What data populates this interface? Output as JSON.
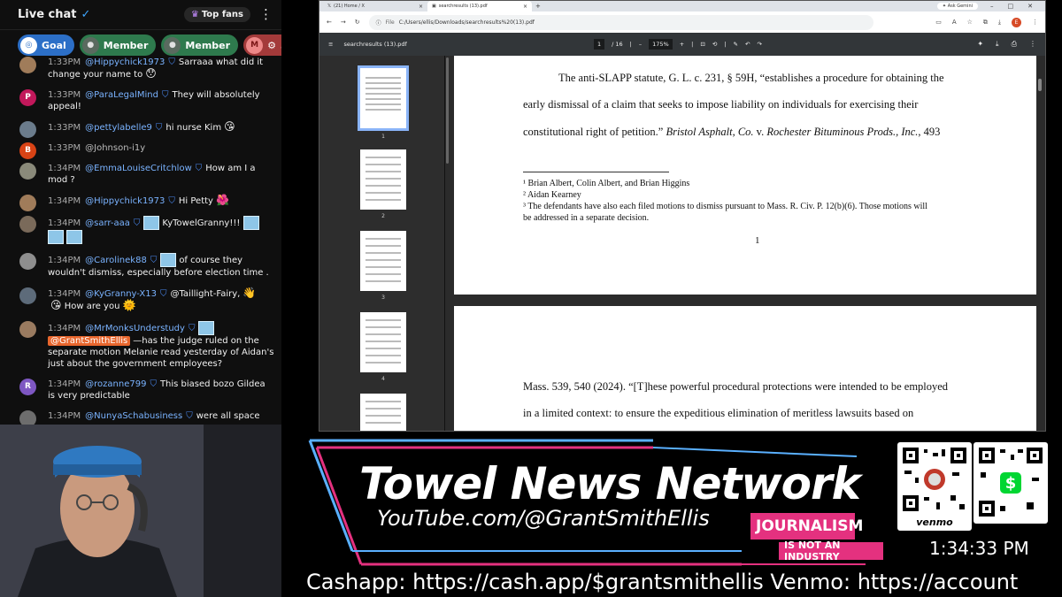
{
  "chat": {
    "title": "Live chat",
    "top_fans": "Top fans",
    "chips": {
      "goal": "Goal",
      "member1": "Member",
      "member2": "Member",
      "m_avatar": "M",
      "m_count": "5"
    },
    "messages": [
      {
        "time": "1:33PM",
        "author": "@Hippychick1973",
        "text": "Sarraaa what did it change your name to",
        "emoji": "😯",
        "avatar_color": "#a07c5a"
      },
      {
        "time": "1:33PM",
        "author": "@ParaLegalMind",
        "text": "They will absolutely appeal!",
        "avatar_letter": "P",
        "avatar_color": "#c2185b"
      },
      {
        "time": "1:33PM",
        "author": "@pettylabelle9",
        "text": "hi nurse Kim",
        "emoji": "😘",
        "avatar_color": "#6b7c8c"
      },
      {
        "time": "1:33PM",
        "author": "@Johnson-i1y",
        "text": "",
        "avatar_letter": "B",
        "avatar_color": "#d84315"
      },
      {
        "time": "1:34PM",
        "author": "@EmmaLouiseCritchlow",
        "text": "How am I a mod ?",
        "avatar_color": "#8a8a7a"
      },
      {
        "time": "1:34PM",
        "author": "@Hippychick1973",
        "text": "Hi Petty",
        "emoji": "🌺",
        "avatar_color": "#a07c5a"
      },
      {
        "time": "1:34PM",
        "author": "@sarr-aaa",
        "text": "KyTowelGranny!!!",
        "avatar_color": "#7a6a5a"
      },
      {
        "time": "1:34PM",
        "author": "@Carolinek88",
        "text": "of course they wouldn't dismiss, especially before election time .",
        "avatar_color": "#8e8e8e"
      },
      {
        "time": "1:34PM",
        "author": "@KyGranny-X13",
        "text": "@Taillight-Fairy,",
        "emoji2": "👋",
        "text2": "How are you",
        "emoji3": "🌞",
        "emoji": "😘",
        "avatar_color": "#5d6b7a"
      },
      {
        "time": "1:34PM",
        "author": "@MrMonksUnderstudy",
        "tag": "@GrantSmithEllis",
        "text": "—has the judge ruled on the separate motion Melanie read yesterday of Aidan's just about the government employees?",
        "avatar_color": "#9a7b60"
      },
      {
        "time": "1:34PM",
        "author": "@rozanne799",
        "text": "This biased bozo Gildea is very predictable",
        "avatar_letter": "R",
        "avatar_color": "#7e57c2"
      },
      {
        "time": "1:34PM",
        "author": "@NunyaSchabusiness",
        "text": "were all space",
        "avatar_color": "#6d6d6d"
      }
    ]
  },
  "browser": {
    "tabs": [
      {
        "label": "(21) Home / X"
      },
      {
        "label": "searchresults (13).pdf"
      }
    ],
    "gemini": "Ask Gemini",
    "url_prefix": "File",
    "url": "C:/Users/ellis/Downloads/searchresults%20(13).pdf",
    "profile_letter": "E",
    "pdf": {
      "filename": "searchresults (13).pdf",
      "page_current": "1",
      "page_total": "/ 16",
      "zoom": "175%",
      "thumb_numbers": [
        "1",
        "2",
        "3",
        "4"
      ],
      "page1": {
        "line1": "The anti-SLAPP statute, G. L. c. 231, § 59H, “establishes a procedure for obtaining the",
        "line2": "early dismissal of a claim that seeks to impose liability on individuals for exercising their",
        "line3a": "constitutional right of petition.”  ",
        "line3b": "Bristol Asphalt, Co.",
        "line3c": " v. ",
        "line3d": "Rochester Bituminous Prods., Inc.",
        "line3e": ", 493",
        "footnote1": "¹ Brian Albert, Colin Albert, and Brian Higgins",
        "footnote2": "² Aidan Kearney",
        "footnote3a": "³ The defendants have also each filed motions to dismiss pursuant to Mass. R. Civ. P. 12(b)(6).  Those motions will",
        "footnote3b": "be addressed in a separate decision.",
        "page_number": "1"
      },
      "page2": {
        "line1": "Mass. 539, 540 (2024). “[T]hese powerful procedural protections were intended to be employed",
        "line2": "in a limited context: to ensure the expeditious elimination of meritless lawsuits based on"
      }
    }
  },
  "overlay": {
    "title": "Towel News Network",
    "url": "YouTube.com/@GrantSmithEllis",
    "journalism": "JOURNALISM",
    "not_industry": "IS NOT AN INDUSTRY",
    "venmo_label": "venmo",
    "clock": "1:34:33 PM",
    "ticker": "Cashapp: https://cash.app/$grantsmithellis Venmo: https://account",
    "colors": {
      "accent_pink": "#e4317f",
      "neon_blue": "#5ab0ff",
      "cashapp_green": "#00d632"
    }
  }
}
